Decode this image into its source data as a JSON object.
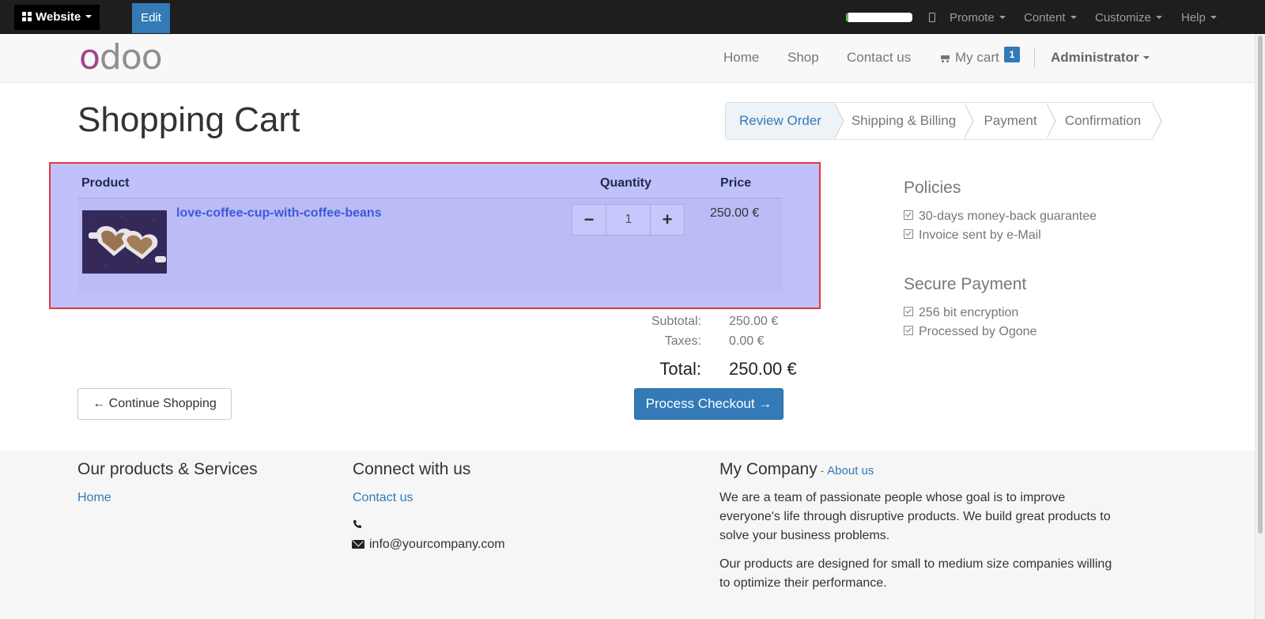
{
  "adminbar": {
    "website_label": "Website",
    "edit_label": "Edit",
    "progress_fraction": 0.04,
    "menus": [
      "Promote",
      "Content",
      "Customize",
      "Help"
    ]
  },
  "navbar": {
    "logo_first": "o",
    "logo_rest": "doo",
    "links": [
      "Home",
      "Shop",
      "Contact us"
    ],
    "cart_label": "My cart",
    "cart_count": "1",
    "user": "Administrator"
  },
  "page": {
    "title": "Shopping Cart"
  },
  "wizard": {
    "steps": [
      "Review Order",
      "Shipping & Billing",
      "Payment",
      "Confirmation"
    ],
    "active_step": "Review Order"
  },
  "cart": {
    "columns": [
      "Product",
      "Quantity",
      "Price"
    ],
    "rows": [
      {
        "product": "love-coffee-cup-with-coffee-beans",
        "quantity": "1",
        "price": "250.00 €",
        "image_icon": "coffee-cup-image"
      }
    ],
    "subtotal_label": "Subtotal:",
    "subtotal": "250.00 €",
    "taxes_label": "Taxes:",
    "taxes": "0.00 €",
    "total_label": "Total:",
    "total": "250.00 €",
    "continue_label": "← Continue Shopping",
    "checkout_label": "Process Checkout →"
  },
  "sidebar": {
    "policies_title": "Policies",
    "policies": [
      "30-days money-back guarantee",
      "Invoice sent by e-Mail"
    ],
    "secure_title": "Secure Payment",
    "secure": [
      "256 bit encryption",
      "Processed by Ogone"
    ]
  },
  "footer": {
    "col1_title": "Our products & Services",
    "col1_link": "Home",
    "col2_title": "Connect with us",
    "col2_link": "Contact us",
    "email": "info@yourcompany.com",
    "col3_title": "My Company",
    "col3_sep": " - ",
    "about_link": "About us",
    "para1_line1": "We are a team of passionate people whose goal is to improve",
    "para1_line2": "everyone's life through disruptive products. We build great products to",
    "para1_line3": "solve your business problems.",
    "para2_line1": "Our products are designed for small to medium size companies willing",
    "para2_line2": "to optimize their performance."
  },
  "colors": {
    "accent": "#337ab7",
    "highlight_border": "#e03a3e",
    "highlight_fill": "#c0c0fb",
    "logo_purple": "#a24689"
  }
}
